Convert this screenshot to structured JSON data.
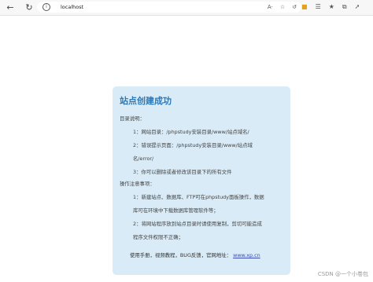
{
  "browser": {
    "url": "localhost",
    "reader_icon": "A·"
  },
  "card": {
    "title": "站点创建成功",
    "dir_header": "目录说明：",
    "dir_items": [
      "1：网站目录：/phpstudy安装目录/www/站点域名/",
      "2：错误提示页面：/phpstudy安装目录/www/站点域",
      "名/error/",
      "3：你可以删除或者修改该目录下的所有文件"
    ],
    "ops_header": "操作注意事项：",
    "ops_items": [
      "1：新建站点、数据库、FTP可在phpstudy面板操作，数据",
      "库可在环境中下载数据库管理软件等；",
      "2：将网站程序放到站点目录时请使用复制，剪切可能造成",
      "程序文件权限不正确；"
    ],
    "footer_text": "使用手册，视频教程，BUG反馈，官网地址：",
    "footer_link": "www.xp.cn"
  },
  "watermark": "CSDN @一个小卷包"
}
